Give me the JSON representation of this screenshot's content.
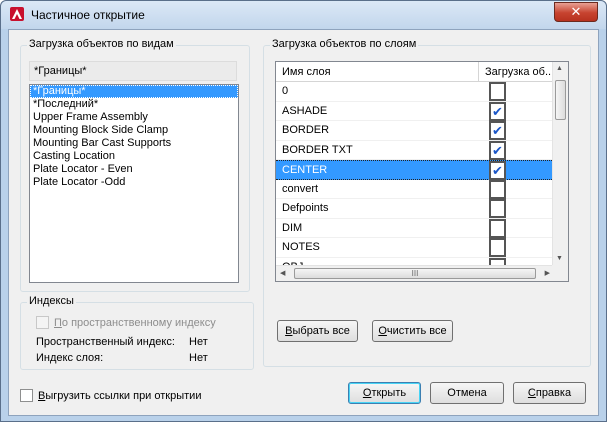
{
  "window": {
    "title": "Частичное открытие",
    "close_glyph": "✕"
  },
  "views": {
    "group_label": "Загрузка объектов по видам",
    "current_value": "*Границы*",
    "items": [
      "*Границы*",
      "*Последний*",
      "Upper Frame Assembly",
      "Mounting Block Side Clamp",
      "Mounting Bar Cast Supports",
      "Casting Location",
      "Plate Locator - Even",
      "Plate Locator -Odd"
    ],
    "selected_index": 0
  },
  "indexes": {
    "group_label": "Индексы",
    "spatial_checkbox_label": "По пространственному индексу",
    "spatial_index_label": "Пространственный индекс:",
    "spatial_index_value": "Нет",
    "layer_index_label": "Индекс слоя:",
    "layer_index_value": "Нет"
  },
  "layers": {
    "group_label": "Загрузка объектов по слоям",
    "col_name": "Имя слоя",
    "col_load": "Загрузка об...",
    "rows": [
      {
        "name": "0",
        "checked": false
      },
      {
        "name": "ASHADE",
        "checked": true
      },
      {
        "name": "BORDER",
        "checked": true
      },
      {
        "name": "BORDER TXT",
        "checked": true
      },
      {
        "name": "CENTER",
        "checked": true,
        "selected": true
      },
      {
        "name": "convert",
        "checked": false
      },
      {
        "name": "Defpoints",
        "checked": false
      },
      {
        "name": "DIM",
        "checked": false
      },
      {
        "name": "NOTES",
        "checked": false
      },
      {
        "name": "OBJ",
        "checked": false
      }
    ],
    "check_glyph": "✔",
    "select_all_label": "Выбрать все",
    "clear_all_label": "Очистить все"
  },
  "unload_xrefs_label": "Выгрузить ссылки при открытии",
  "buttons": {
    "open": "Открыть",
    "cancel": "Отмена",
    "help": "Справка"
  },
  "colors": {
    "selection": "#3399ff",
    "checkmark": "#1a56c8",
    "close_button": "#c7432f"
  }
}
